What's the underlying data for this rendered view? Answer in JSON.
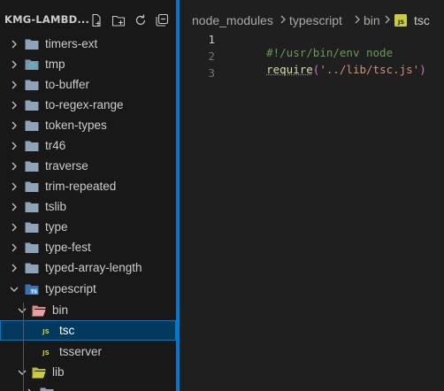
{
  "sidebar": {
    "title": "KMG-LAMBD...",
    "actions": [
      "new-file-icon",
      "new-folder-icon",
      "refresh-icon",
      "collapse-all-icon"
    ],
    "items": [
      {
        "label": "timers-ext",
        "type": "folder",
        "expanded": false
      },
      {
        "label": "tmp",
        "type": "folder-special",
        "expanded": false
      },
      {
        "label": "to-buffer",
        "type": "folder",
        "expanded": false
      },
      {
        "label": "to-regex-range",
        "type": "folder",
        "expanded": false
      },
      {
        "label": "token-types",
        "type": "folder",
        "expanded": false
      },
      {
        "label": "tr46",
        "type": "folder",
        "expanded": false
      },
      {
        "label": "traverse",
        "type": "folder",
        "expanded": false
      },
      {
        "label": "trim-repeated",
        "type": "folder",
        "expanded": false
      },
      {
        "label": "tslib",
        "type": "folder",
        "expanded": false
      },
      {
        "label": "type",
        "type": "folder",
        "expanded": false
      },
      {
        "label": "type-fest",
        "type": "folder",
        "expanded": false
      },
      {
        "label": "typed-array-length",
        "type": "folder",
        "expanded": false
      },
      {
        "label": "typescript",
        "type": "folder-ts",
        "expanded": true
      },
      {
        "label": "bin",
        "type": "folder-bin",
        "expanded": true
      },
      {
        "label": "tsc",
        "type": "file-js",
        "selected": true
      },
      {
        "label": "tsserver",
        "type": "file-js"
      },
      {
        "label": "lib",
        "type": "folder-lib",
        "expanded": true
      }
    ]
  },
  "breadcrumb": [
    "node_modules",
    "typescript",
    "bin",
    "tsc"
  ],
  "breadcrumb_file_icon": "JS",
  "editor": {
    "line_numbers": [
      "1",
      "2",
      "3"
    ],
    "line1": "#!/usr/bin/env node",
    "line2_fn": "require",
    "line2_open": "(",
    "line2_str": "'../lib/tsc.js'",
    "line2_close": ")"
  },
  "colors": {
    "accent": "#0078d4",
    "selection": "#04395e",
    "folder": "#8fa3b8",
    "js_badge": "#cbcb41",
    "comment": "#6a9955",
    "function": "#dcdcaa",
    "string": "#ce9178",
    "paren": "#da70d6"
  }
}
